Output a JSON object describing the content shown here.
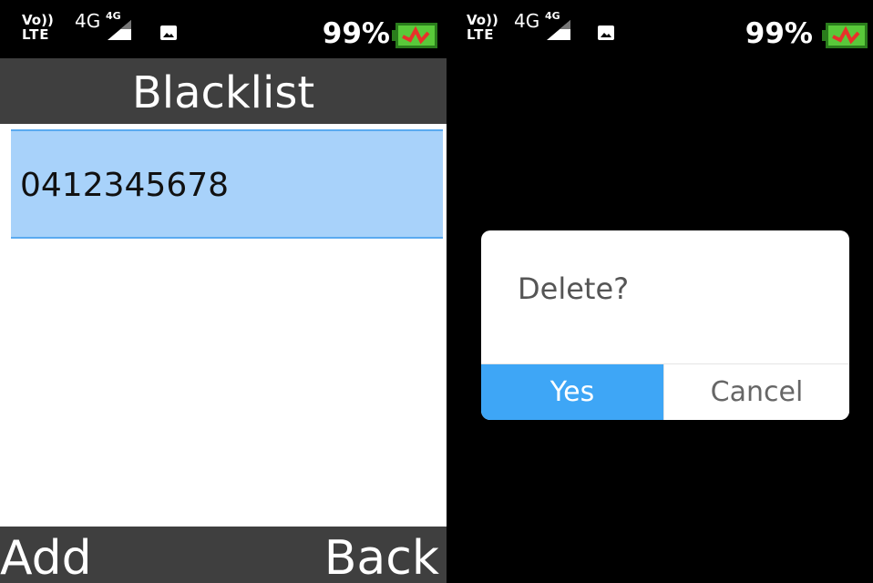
{
  "status_bar": {
    "volte_top": "Vo))",
    "volte_bottom": "LTE",
    "network_primary": "4G",
    "network_secondary": "4G",
    "battery_percent": "99%",
    "colors": {
      "battery_fill": "#59c93a",
      "charge_bolt": "#e8312a"
    }
  },
  "left_screen": {
    "title": "Blacklist",
    "list": [
      {
        "number": "0412345678",
        "selected": true
      }
    ],
    "soft_keys": {
      "left": "Add",
      "right": "Back"
    }
  },
  "right_screen": {
    "dialog": {
      "message": "Delete?",
      "yes_label": "Yes",
      "cancel_label": "Cancel"
    }
  },
  "colors": {
    "header_bg": "#3f3f3f",
    "selection_bg": "#a8d2fa",
    "selection_border": "#5aaaf0",
    "primary_button": "#3ea6f6"
  }
}
